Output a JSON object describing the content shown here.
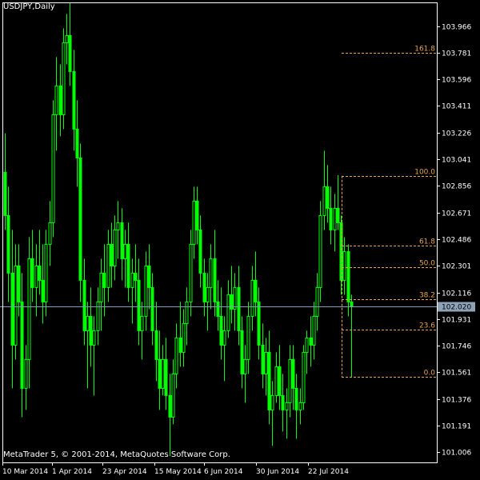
{
  "chart_title": "USDJPY,Daily",
  "copyright": "MetaTrader 5, © 2001-2014, MetaQuotes Software Corp.",
  "colors": {
    "background": "#000000",
    "candle": "#00ff00",
    "axis": "#ffffff",
    "fib": "#e8a34c",
    "price_line": "#7f9fbf",
    "price_tag_bg": "#8fa3b8"
  },
  "chart_data": {
    "type": "candlestick",
    "symbol": "USDJPY",
    "timeframe": "Daily",
    "ylim": [
      100.95,
      104.13
    ],
    "y_ticks": [
      "103.966",
      "103.781",
      "103.596",
      "103.411",
      "103.226",
      "103.041",
      "102.856",
      "102.671",
      "102.486",
      "102.301",
      "102.116",
      "101.931",
      "101.746",
      "101.561",
      "101.376",
      "101.191",
      "101.006"
    ],
    "x_ticks": [
      "10 Mar 2014",
      "1 Apr 2014",
      "23 Apr 2014",
      "15 May 2014",
      "6 Jun 2014",
      "30 Jun 2014",
      "22 Jul 2014"
    ],
    "current_price": "102.020",
    "fibonacci": [
      {
        "label": "161.8",
        "value": 103.781
      },
      {
        "label": "100.0",
        "value": 102.926
      },
      {
        "label": "61.8",
        "value": 102.441
      },
      {
        "label": "50.0",
        "value": 102.291
      },
      {
        "label": "38.2",
        "value": 102.071
      },
      {
        "label": "23.6",
        "value": 101.856
      },
      {
        "label": "0.0",
        "value": 101.531
      }
    ],
    "ohlc": [
      {
        "o": 102.95,
        "h": 103.22,
        "l": 102.55,
        "c": 102.65
      },
      {
        "o": 102.65,
        "h": 102.85,
        "l": 102.05,
        "c": 102.25
      },
      {
        "o": 102.25,
        "h": 102.55,
        "l": 101.45,
        "c": 101.75
      },
      {
        "o": 101.75,
        "h": 102.45,
        "l": 101.65,
        "c": 102.3
      },
      {
        "o": 102.3,
        "h": 102.45,
        "l": 101.95,
        "c": 102.05
      },
      {
        "o": 102.05,
        "h": 102.25,
        "l": 101.25,
        "c": 101.45
      },
      {
        "o": 101.45,
        "h": 101.75,
        "l": 101.3,
        "c": 101.65
      },
      {
        "o": 101.65,
        "h": 102.5,
        "l": 101.45,
        "c": 102.35
      },
      {
        "o": 102.35,
        "h": 102.55,
        "l": 102.05,
        "c": 102.15
      },
      {
        "o": 102.15,
        "h": 102.45,
        "l": 101.95,
        "c": 102.3
      },
      {
        "o": 102.3,
        "h": 102.55,
        "l": 102.1,
        "c": 102.2
      },
      {
        "o": 102.2,
        "h": 102.45,
        "l": 101.9,
        "c": 102.05
      },
      {
        "o": 102.05,
        "h": 102.55,
        "l": 101.95,
        "c": 102.45
      },
      {
        "o": 102.45,
        "h": 102.75,
        "l": 102.3,
        "c": 102.6
      },
      {
        "o": 102.6,
        "h": 103.45,
        "l": 102.5,
        "c": 103.35
      },
      {
        "o": 103.35,
        "h": 103.75,
        "l": 103.1,
        "c": 103.55
      },
      {
        "o": 103.55,
        "h": 103.7,
        "l": 103.2,
        "c": 103.35
      },
      {
        "o": 103.35,
        "h": 103.95,
        "l": 103.25,
        "c": 103.85
      },
      {
        "o": 103.85,
        "h": 104.05,
        "l": 103.7,
        "c": 103.9
      },
      {
        "o": 103.9,
        "h": 104.13,
        "l": 103.55,
        "c": 103.65
      },
      {
        "o": 103.65,
        "h": 103.8,
        "l": 103.1,
        "c": 103.25
      },
      {
        "o": 103.25,
        "h": 103.45,
        "l": 102.85,
        "c": 103.05
      },
      {
        "o": 103.05,
        "h": 103.15,
        "l": 102.05,
        "c": 102.2
      },
      {
        "o": 102.2,
        "h": 102.35,
        "l": 101.75,
        "c": 101.85
      },
      {
        "o": 101.85,
        "h": 102.05,
        "l": 101.45,
        "c": 101.95
      },
      {
        "o": 101.95,
        "h": 102.15,
        "l": 101.6,
        "c": 101.75
      },
      {
        "o": 101.75,
        "h": 101.95,
        "l": 101.4,
        "c": 101.85
      },
      {
        "o": 101.85,
        "h": 102.15,
        "l": 101.75,
        "c": 102.05
      },
      {
        "o": 102.05,
        "h": 102.35,
        "l": 101.85,
        "c": 102.25
      },
      {
        "o": 102.25,
        "h": 102.45,
        "l": 101.95,
        "c": 102.15
      },
      {
        "o": 102.15,
        "h": 102.55,
        "l": 102.05,
        "c": 102.45
      },
      {
        "o": 102.45,
        "h": 102.6,
        "l": 102.15,
        "c": 102.3
      },
      {
        "o": 102.3,
        "h": 102.65,
        "l": 102.2,
        "c": 102.55
      },
      {
        "o": 102.55,
        "h": 102.75,
        "l": 102.35,
        "c": 102.6
      },
      {
        "o": 102.6,
        "h": 102.7,
        "l": 102.2,
        "c": 102.35
      },
      {
        "o": 102.35,
        "h": 102.55,
        "l": 102.15,
        "c": 102.45
      },
      {
        "o": 102.45,
        "h": 102.6,
        "l": 102.05,
        "c": 102.15
      },
      {
        "o": 102.15,
        "h": 102.35,
        "l": 101.9,
        "c": 102.25
      },
      {
        "o": 102.25,
        "h": 102.45,
        "l": 102.05,
        "c": 102.2
      },
      {
        "o": 102.2,
        "h": 102.35,
        "l": 101.75,
        "c": 101.85
      },
      {
        "o": 101.85,
        "h": 102.05,
        "l": 101.65,
        "c": 101.95
      },
      {
        "o": 101.95,
        "h": 102.4,
        "l": 101.85,
        "c": 102.3
      },
      {
        "o": 102.3,
        "h": 102.45,
        "l": 102.0,
        "c": 102.15
      },
      {
        "o": 102.15,
        "h": 102.25,
        "l": 101.75,
        "c": 101.85
      },
      {
        "o": 101.85,
        "h": 102.05,
        "l": 101.5,
        "c": 101.65
      },
      {
        "o": 101.65,
        "h": 101.85,
        "l": 101.3,
        "c": 101.45
      },
      {
        "o": 101.45,
        "h": 101.75,
        "l": 101.4,
        "c": 101.65
      },
      {
        "o": 101.65,
        "h": 101.8,
        "l": 101.3,
        "c": 101.4
      },
      {
        "o": 101.4,
        "h": 101.55,
        "l": 100.98,
        "c": 101.25
      },
      {
        "o": 101.25,
        "h": 101.65,
        "l": 101.2,
        "c": 101.55
      },
      {
        "o": 101.55,
        "h": 101.9,
        "l": 101.45,
        "c": 101.8
      },
      {
        "o": 101.8,
        "h": 102.05,
        "l": 101.6,
        "c": 101.7
      },
      {
        "o": 101.7,
        "h": 102.0,
        "l": 101.6,
        "c": 101.9
      },
      {
        "o": 101.9,
        "h": 102.15,
        "l": 101.75,
        "c": 102.05
      },
      {
        "o": 102.05,
        "h": 102.55,
        "l": 101.95,
        "c": 102.45
      },
      {
        "o": 102.45,
        "h": 102.85,
        "l": 102.35,
        "c": 102.75
      },
      {
        "o": 102.75,
        "h": 102.85,
        "l": 102.45,
        "c": 102.55
      },
      {
        "o": 102.55,
        "h": 102.65,
        "l": 102.15,
        "c": 102.25
      },
      {
        "o": 102.25,
        "h": 102.35,
        "l": 101.95,
        "c": 102.05
      },
      {
        "o": 102.05,
        "h": 102.25,
        "l": 101.85,
        "c": 102.15
      },
      {
        "o": 102.15,
        "h": 102.45,
        "l": 102.0,
        "c": 102.35
      },
      {
        "o": 102.35,
        "h": 102.55,
        "l": 101.95,
        "c": 102.05
      },
      {
        "o": 102.05,
        "h": 102.2,
        "l": 101.85,
        "c": 101.95
      },
      {
        "o": 101.95,
        "h": 102.15,
        "l": 101.65,
        "c": 101.75
      },
      {
        "o": 101.75,
        "h": 101.95,
        "l": 101.5,
        "c": 101.85
      },
      {
        "o": 101.85,
        "h": 102.2,
        "l": 101.8,
        "c": 102.1
      },
      {
        "o": 102.1,
        "h": 102.3,
        "l": 101.9,
        "c": 102.0
      },
      {
        "o": 102.0,
        "h": 102.25,
        "l": 101.85,
        "c": 102.15
      },
      {
        "o": 102.15,
        "h": 102.3,
        "l": 101.75,
        "c": 101.85
      },
      {
        "o": 101.85,
        "h": 101.95,
        "l": 101.45,
        "c": 101.55
      },
      {
        "o": 101.55,
        "h": 101.75,
        "l": 101.35,
        "c": 101.65
      },
      {
        "o": 101.65,
        "h": 102.05,
        "l": 101.55,
        "c": 101.95
      },
      {
        "o": 101.95,
        "h": 102.3,
        "l": 101.85,
        "c": 102.2
      },
      {
        "o": 102.2,
        "h": 102.4,
        "l": 101.95,
        "c": 102.05
      },
      {
        "o": 102.05,
        "h": 102.15,
        "l": 101.65,
        "c": 101.75
      },
      {
        "o": 101.75,
        "h": 101.9,
        "l": 101.45,
        "c": 101.55
      },
      {
        "o": 101.55,
        "h": 101.8,
        "l": 101.4,
        "c": 101.7
      },
      {
        "o": 101.7,
        "h": 101.85,
        "l": 101.2,
        "c": 101.3
      },
      {
        "o": 101.3,
        "h": 101.5,
        "l": 101.05,
        "c": 101.4
      },
      {
        "o": 101.4,
        "h": 101.7,
        "l": 101.35,
        "c": 101.6
      },
      {
        "o": 101.6,
        "h": 101.75,
        "l": 101.3,
        "c": 101.4
      },
      {
        "o": 101.4,
        "h": 101.55,
        "l": 101.15,
        "c": 101.3
      },
      {
        "o": 101.3,
        "h": 101.45,
        "l": 101.1,
        "c": 101.35
      },
      {
        "o": 101.35,
        "h": 101.75,
        "l": 101.25,
        "c": 101.65
      },
      {
        "o": 101.65,
        "h": 101.75,
        "l": 101.3,
        "c": 101.45
      },
      {
        "o": 101.45,
        "h": 101.55,
        "l": 101.1,
        "c": 101.3
      },
      {
        "o": 101.3,
        "h": 101.45,
        "l": 101.2,
        "c": 101.35
      },
      {
        "o": 101.35,
        "h": 101.75,
        "l": 101.3,
        "c": 101.7
      },
      {
        "o": 101.7,
        "h": 101.85,
        "l": 101.55,
        "c": 101.8
      },
      {
        "o": 101.8,
        "h": 101.95,
        "l": 101.6,
        "c": 101.75
      },
      {
        "o": 101.75,
        "h": 102.05,
        "l": 101.65,
        "c": 101.95
      },
      {
        "o": 101.95,
        "h": 102.25,
        "l": 101.85,
        "c": 102.15
      },
      {
        "o": 102.15,
        "h": 102.75,
        "l": 102.05,
        "c": 102.65
      },
      {
        "o": 102.65,
        "h": 103.1,
        "l": 102.55,
        "c": 102.85
      },
      {
        "o": 102.85,
        "h": 103.0,
        "l": 102.6,
        "c": 102.7
      },
      {
        "o": 102.7,
        "h": 102.85,
        "l": 102.45,
        "c": 102.55
      },
      {
        "o": 102.55,
        "h": 102.8,
        "l": 102.4,
        "c": 102.7
      },
      {
        "o": 102.7,
        "h": 102.93,
        "l": 102.55,
        "c": 102.6
      },
      {
        "o": 102.6,
        "h": 102.65,
        "l": 102.1,
        "c": 102.2
      },
      {
        "o": 102.2,
        "h": 102.5,
        "l": 102.1,
        "c": 102.4
      },
      {
        "o": 102.4,
        "h": 102.45,
        "l": 101.95,
        "c": 102.05
      },
      {
        "o": 102.05,
        "h": 102.1,
        "l": 101.53,
        "c": 102.02
      }
    ]
  }
}
